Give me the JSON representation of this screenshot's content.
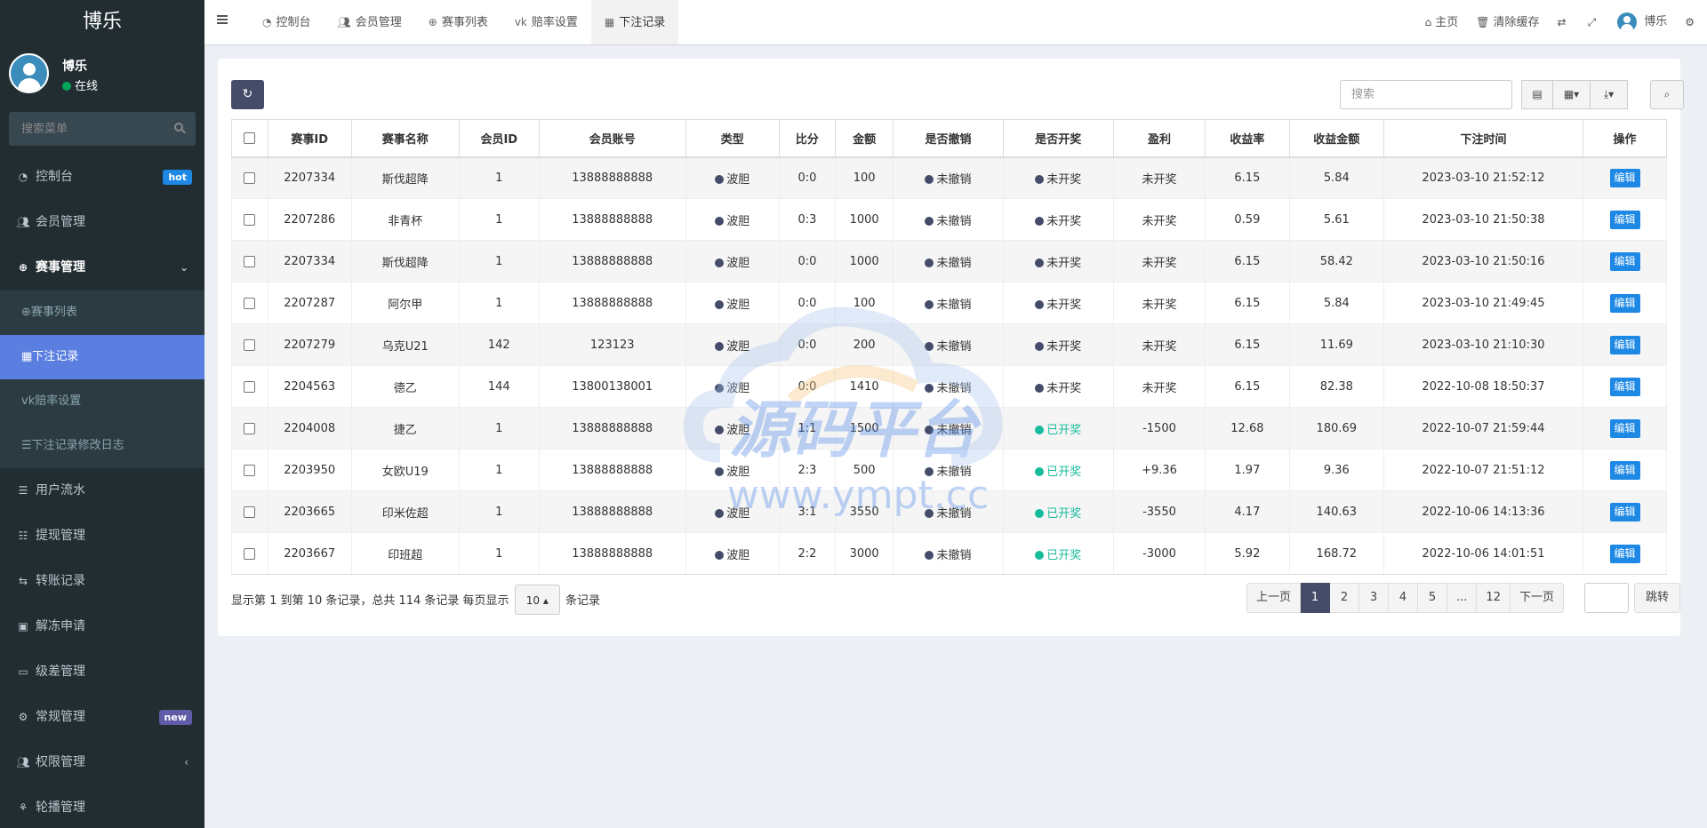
{
  "app": {
    "logo": "博乐"
  },
  "user": {
    "name": "博乐",
    "status": "在线"
  },
  "sidebar": {
    "search_placeholder": "搜索菜单",
    "items": [
      {
        "label": "控制台",
        "icon": "dashboard-icon",
        "badge": "hot"
      },
      {
        "label": "会员管理",
        "icon": "users-icon"
      },
      {
        "label": "赛事管理",
        "icon": "soccer-ball-icon"
      },
      {
        "label": "用户流水",
        "icon": "list-icon"
      },
      {
        "label": "提现管理",
        "icon": "list-ol-icon"
      },
      {
        "label": "转账记录",
        "icon": "transfer-icon"
      },
      {
        "label": "解冻申请",
        "icon": "image-icon"
      },
      {
        "label": "级差管理",
        "icon": "window-icon"
      },
      {
        "label": "常规管理",
        "icon": "cogs-icon",
        "badge": "new"
      },
      {
        "label": "权限管理",
        "icon": "group-icon"
      },
      {
        "label": "轮播管理",
        "icon": "carousel-icon"
      }
    ],
    "submenu": [
      {
        "label": "赛事列表"
      },
      {
        "label": "下注记录"
      },
      {
        "label": "赔率设置"
      },
      {
        "label": "下注记录修改日志"
      }
    ]
  },
  "header": {
    "tabs": [
      {
        "label": "控制台"
      },
      {
        "label": "会员管理"
      },
      {
        "label": "赛事列表"
      },
      {
        "label": "赔率设置"
      },
      {
        "label": "下注记录"
      }
    ],
    "right": {
      "home": "主页",
      "clear_cache": "清除缓存",
      "user": "博乐"
    }
  },
  "toolbar": {
    "search_placeholder": "搜索"
  },
  "table": {
    "columns": [
      "赛事ID",
      "赛事名称",
      "会员ID",
      "会员账号",
      "类型",
      "比分",
      "金额",
      "是否撤销",
      "是否开奖",
      "盈利",
      "收益率",
      "收益金额",
      "下注时间",
      "操作"
    ],
    "edit_label": "编辑",
    "rows": [
      {
        "match_id": "2207334",
        "match_name": "斯伐超降",
        "member_id": "1",
        "account": "13888888888",
        "type": "波胆",
        "score": "0:0",
        "amount": "100",
        "cancelled": "未撤销",
        "drawn": "未开奖",
        "drawn_state": "no",
        "profit": "未开奖",
        "rate": "6.15",
        "income": "5.84",
        "time": "2023-03-10 21:52:12"
      },
      {
        "match_id": "2207286",
        "match_name": "非青杯",
        "member_id": "1",
        "account": "13888888888",
        "type": "波胆",
        "score": "0:3",
        "amount": "1000",
        "cancelled": "未撤销",
        "drawn": "未开奖",
        "drawn_state": "no",
        "profit": "未开奖",
        "rate": "0.59",
        "income": "5.61",
        "time": "2023-03-10 21:50:38"
      },
      {
        "match_id": "2207334",
        "match_name": "斯伐超降",
        "member_id": "1",
        "account": "13888888888",
        "type": "波胆",
        "score": "0:0",
        "amount": "1000",
        "cancelled": "未撤销",
        "drawn": "未开奖",
        "drawn_state": "no",
        "profit": "未开奖",
        "rate": "6.15",
        "income": "58.42",
        "time": "2023-03-10 21:50:16"
      },
      {
        "match_id": "2207287",
        "match_name": "阿尔甲",
        "member_id": "1",
        "account": "13888888888",
        "type": "波胆",
        "score": "0:0",
        "amount": "100",
        "cancelled": "未撤销",
        "drawn": "未开奖",
        "drawn_state": "no",
        "profit": "未开奖",
        "rate": "6.15",
        "income": "5.84",
        "time": "2023-03-10 21:49:45"
      },
      {
        "match_id": "2207279",
        "match_name": "乌克U21",
        "member_id": "142",
        "account": "123123",
        "type": "波胆",
        "score": "0:0",
        "amount": "200",
        "cancelled": "未撤销",
        "drawn": "未开奖",
        "drawn_state": "no",
        "profit": "未开奖",
        "rate": "6.15",
        "income": "11.69",
        "time": "2023-03-10 21:10:30"
      },
      {
        "match_id": "2204563",
        "match_name": "德乙",
        "member_id": "144",
        "account": "13800138001",
        "type": "波胆",
        "score": "0:0",
        "amount": "1410",
        "cancelled": "未撤销",
        "drawn": "未开奖",
        "drawn_state": "no",
        "profit": "未开奖",
        "rate": "6.15",
        "income": "82.38",
        "time": "2022-10-08 18:50:37"
      },
      {
        "match_id": "2204008",
        "match_name": "捷乙",
        "member_id": "1",
        "account": "13888888888",
        "type": "波胆",
        "score": "1:1",
        "amount": "1500",
        "cancelled": "未撤销",
        "drawn": "已开奖",
        "drawn_state": "yes",
        "profit": "-1500",
        "rate": "12.68",
        "income": "180.69",
        "time": "2022-10-07 21:59:44"
      },
      {
        "match_id": "2203950",
        "match_name": "女欧U19",
        "member_id": "1",
        "account": "13888888888",
        "type": "波胆",
        "score": "2:3",
        "amount": "500",
        "cancelled": "未撤销",
        "drawn": "已开奖",
        "drawn_state": "yes",
        "profit": "+9.36",
        "rate": "1.97",
        "income": "9.36",
        "time": "2022-10-07 21:51:12"
      },
      {
        "match_id": "2203665",
        "match_name": "印米佐超",
        "member_id": "1",
        "account": "13888888888",
        "type": "波胆",
        "score": "3:1",
        "amount": "3550",
        "cancelled": "未撤销",
        "drawn": "已开奖",
        "drawn_state": "yes",
        "profit": "-3550",
        "rate": "4.17",
        "income": "140.63",
        "time": "2022-10-06 14:13:36"
      },
      {
        "match_id": "2203667",
        "match_name": "印班超",
        "member_id": "1",
        "account": "13888888888",
        "type": "波胆",
        "score": "2:2",
        "amount": "3000",
        "cancelled": "未撤销",
        "drawn": "已开奖",
        "drawn_state": "yes",
        "profit": "-3000",
        "rate": "5.92",
        "income": "168.72",
        "time": "2022-10-06 14:01:51"
      }
    ]
  },
  "footer": {
    "info_prefix": "显示第 1 到第 10 条记录，总共 114 条记录 每页显示",
    "page_size": "10",
    "info_suffix": "条记录",
    "pagination": [
      "上一页",
      "1",
      "2",
      "3",
      "4",
      "5",
      "...",
      "12",
      "下一页"
    ],
    "current_page": "1",
    "jump_label": "跳转"
  },
  "watermark": {
    "text": "源码平台",
    "url": "www.ympt.cc"
  },
  "colors": {
    "sidebar_bg": "#222d32",
    "active_menu": "#5b7fe0",
    "primary": "#444c69",
    "edit_button": "#1e88e5",
    "green": "#18bc9c"
  }
}
